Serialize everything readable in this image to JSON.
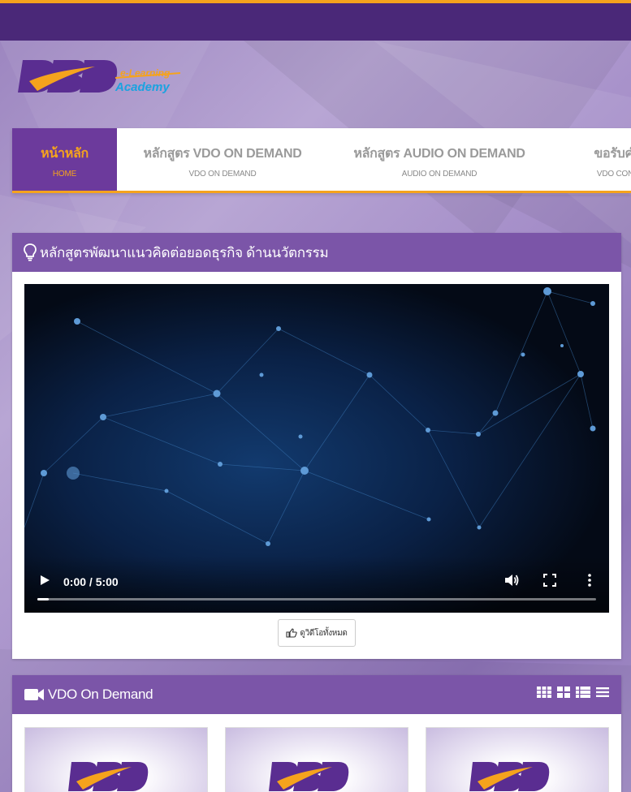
{
  "header": {
    "logo_main": "DBD",
    "logo_sub1": "e-Learning",
    "logo_sub2": "Academy"
  },
  "nav": {
    "items": [
      {
        "label": "หน้าหลัก",
        "sub": "HOME",
        "active": true
      },
      {
        "label": "หลักสูตร VDO ON DEMAND",
        "sub": "VDO ON DEMAND",
        "active": false
      },
      {
        "label": "หลักสูตร AUDIO ON DEMAND",
        "sub": "AUDIO ON DEMAND",
        "active": false
      },
      {
        "label": "ขอรับคำป",
        "sub": "VDO CONFEI",
        "active": false
      }
    ]
  },
  "featured": {
    "title": "หลักสูตรพัฒนาแนวคิดต่อยอดธุรกิจ ด้านนวัตกรรม",
    "icon": "lightbulb-icon",
    "player": {
      "time": "0:00 / 5:00",
      "progress": 0.02
    },
    "all_button": "ดูวิดีโอทั้งหมด",
    "all_button_icon": "thumbs-up-icon"
  },
  "vdo_section": {
    "title": "VDO On Demand",
    "icon": "video-camera-icon",
    "view_modes": [
      "grid-small-icon",
      "grid-large-icon",
      "list-detail-icon",
      "list-icon"
    ],
    "cards": [
      {
        "logo": "DBD"
      },
      {
        "logo": "DBD"
      },
      {
        "logo": "DBD"
      }
    ]
  },
  "colors": {
    "brand_purple": "#4a2878",
    "panel_purple": "#7b55a8",
    "accent_orange": "#f5a31d"
  }
}
